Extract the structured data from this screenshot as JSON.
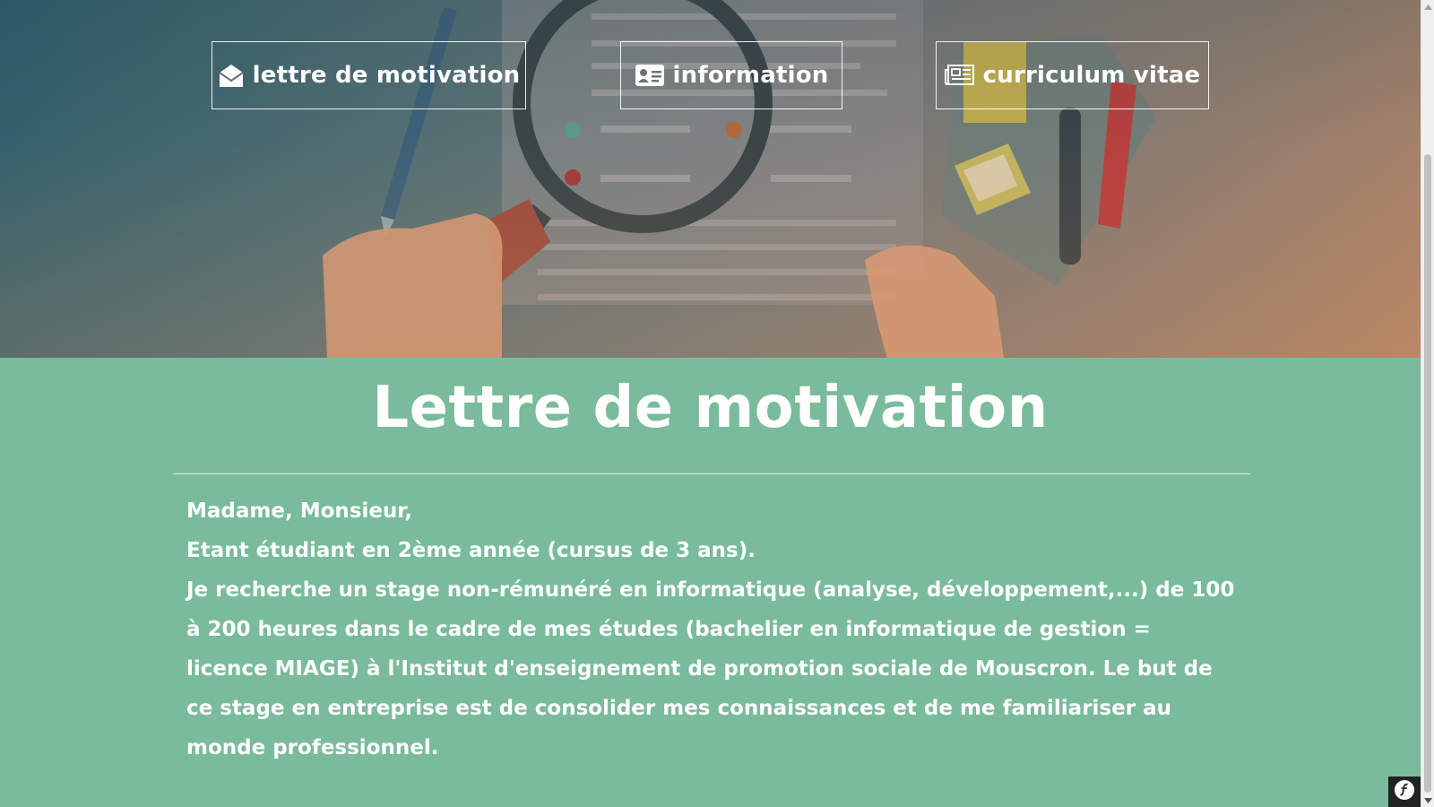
{
  "nav": {
    "lettre_label": "lettre de motivation",
    "info_label": "information",
    "cv_label": "curriculum vitae"
  },
  "icons": {
    "lettre": "envelope-open-icon",
    "info": "id-card-icon",
    "cv": "newspaper-icon",
    "toolbar": "symfony-logo-icon"
  },
  "main": {
    "title": "Lettre de motivation",
    "letter": {
      "greeting": "Madame, Monsieur,",
      "line1": "Etant étudiant en 2ème année (cursus de 3 ans).",
      "body": "Je recherche un stage non-rémunéré en informatique (analyse, développement,...) de 100 à 200 heures dans le cadre de mes études (bachelier en informatique de gestion = licence MIAGE) à l'Institut d'enseignement de promotion sociale de Mouscron. Le but de ce stage en entreprise est de consolider mes connaissances et de me familiariser au monde professionnel."
    }
  },
  "colors": {
    "content_bg": "#79bb9b",
    "text": "#ffffff"
  }
}
